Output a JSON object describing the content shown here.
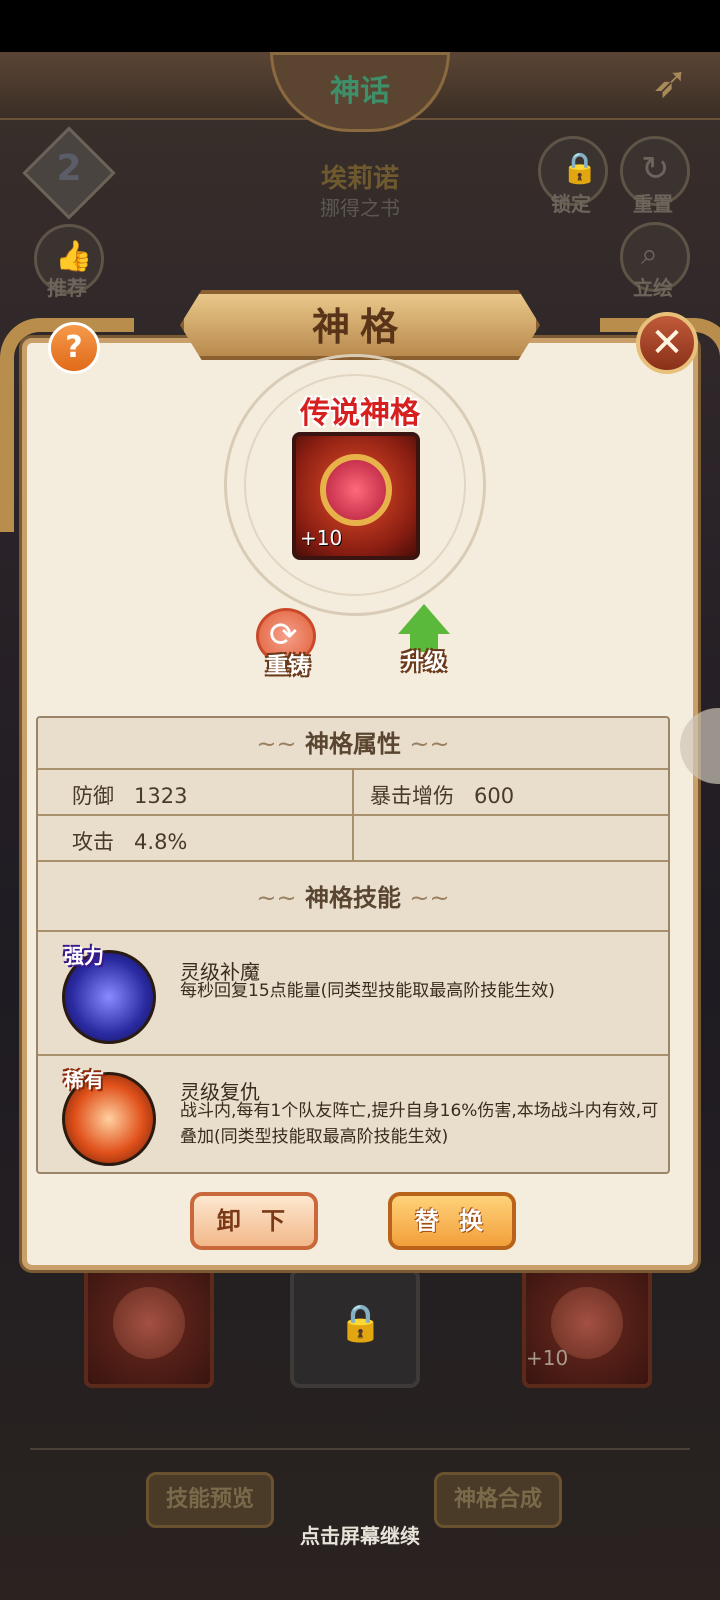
{
  "background": {
    "top_title": "神话",
    "hero_name": "埃莉诺",
    "hero_subtitle": "挪得之书",
    "level": "2",
    "left_buttons": [
      {
        "label": "推荐",
        "icon": "thumbs-up-icon"
      }
    ],
    "right_buttons": [
      {
        "label": "锁定",
        "icon": "lock-icon"
      },
      {
        "label": "重置",
        "icon": "reset-icon"
      },
      {
        "label": "立绘",
        "icon": "magnifier-icon"
      }
    ],
    "card_plus": "+10",
    "bottom_buttons": [
      "技能预览",
      "神格合成"
    ],
    "tap_hint": "点击屏幕继续"
  },
  "modal": {
    "title": "神格",
    "help_symbol": "?",
    "close_symbol": "✕",
    "rarity": "传说神格",
    "item_plus": "+10",
    "actions": [
      {
        "label": "重铸",
        "icon": "recast-icon"
      },
      {
        "label": "升级",
        "icon": "upgrade-arrow-icon"
      }
    ],
    "attributes": {
      "heading": "神格属性",
      "rows": [
        {
          "left_label": "防御",
          "left_value": "1323",
          "right_label": "暴击增伤",
          "right_value": "600"
        },
        {
          "left_label": "攻击",
          "left_value": "4.8%",
          "right_label": "",
          "right_value": ""
        }
      ]
    },
    "skills": {
      "heading": "神格技能",
      "items": [
        {
          "tag": "强力",
          "name": "灵级补魔",
          "desc": "每秒回复15点能量(同类型技能取最高阶技能生效)",
          "color": "#3a3acf"
        },
        {
          "tag": "稀有",
          "name": "灵级复仇",
          "desc": "战斗内,每有1个队友阵亡,提升自身16%伤害,本场战斗内有效,可叠加(同类型技能取最高阶技能生效)",
          "color": "#e0501a"
        }
      ]
    },
    "buttons": {
      "unequip": "卸 下",
      "replace": "替 换"
    },
    "swirl": "~"
  }
}
